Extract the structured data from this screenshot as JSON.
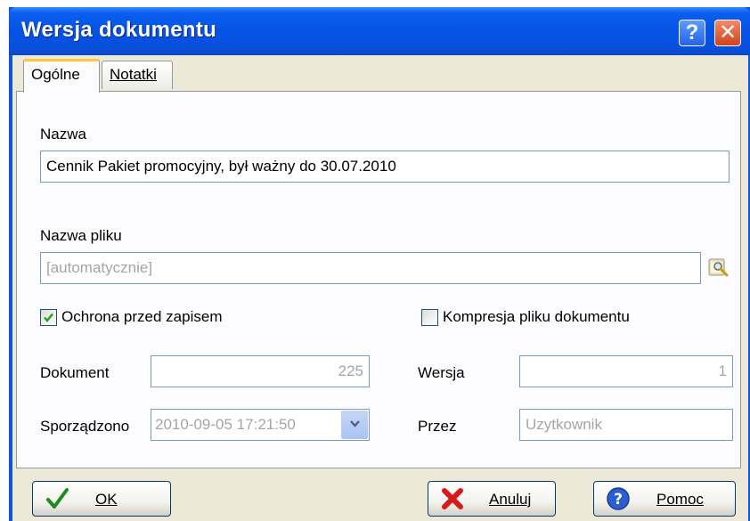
{
  "window": {
    "title": "Wersja dokumentu",
    "help_glyph": "?",
    "close_glyph": "✕"
  },
  "tabs": [
    {
      "label": "Ogólne",
      "active": true
    },
    {
      "label": "Notatki",
      "active": false
    }
  ],
  "form": {
    "name_label": "Nazwa",
    "name_value": "Cennik Pakiet promocyjny, był ważny do 30.07.2010",
    "filename_label": "Nazwa pliku",
    "filename_value": "[automatycznie]",
    "browse_icon": "folder-search-icon",
    "write_protect_label": "Ochrona przed zapisem",
    "write_protect_checked": true,
    "compress_label": "Kompresja pliku dokumentu",
    "compress_checked": false,
    "document_label": "Dokument",
    "document_value": "225",
    "version_label": "Wersja",
    "version_value": "1",
    "created_label": "Sporządzono",
    "created_value": "2010-09-05 17:21:50",
    "by_label": "Przez",
    "by_value": "Uzytkownik"
  },
  "buttons": {
    "ok": "OK",
    "cancel": "Anuluj",
    "help": "Pomoc"
  },
  "colors": {
    "titlebar": "#0653e3",
    "client": "#ece9d8",
    "field_border": "#7f9db9",
    "accent_tab": "#ffc73c"
  }
}
